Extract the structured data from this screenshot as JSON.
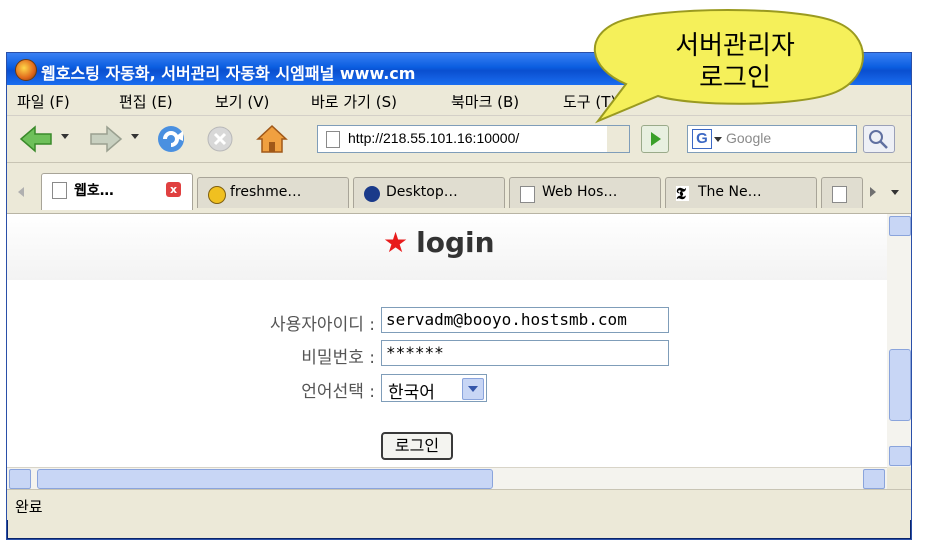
{
  "browser": {
    "title": "웹호스팅 자동화, 서버관리 자동화 시엠패널 www.cm",
    "menu": [
      "파일 (F)",
      "편집 (E)",
      "보기 (V)",
      "바로 가기 (S)",
      "북마크 (B)",
      "도구 (T)"
    ],
    "url": "http://218.55.101.16:10000/",
    "search_placeholder": "Google",
    "tabs": [
      {
        "label": "웹호…",
        "active": true
      },
      {
        "label": "freshme…"
      },
      {
        "label": "Desktop…"
      },
      {
        "label": "Web Hos…"
      },
      {
        "label": "The Ne…"
      }
    ],
    "status": "완료",
    "colors": {
      "titlebar": "#0a5de0",
      "accent_star": "#e81c1c",
      "bubble": "#f5f05a"
    }
  },
  "page": {
    "heading": "login",
    "form": {
      "username_label": "사용자아이디 :",
      "username_value": "servadm@booyo.hostsmb.com",
      "password_label": "비밀번호 :",
      "password_value": "******",
      "language_label": "언어선택 :",
      "language_value": "한국어",
      "submit_label": "로그인"
    }
  },
  "callout": {
    "line1": "서버관리자",
    "line2": "로그인"
  }
}
